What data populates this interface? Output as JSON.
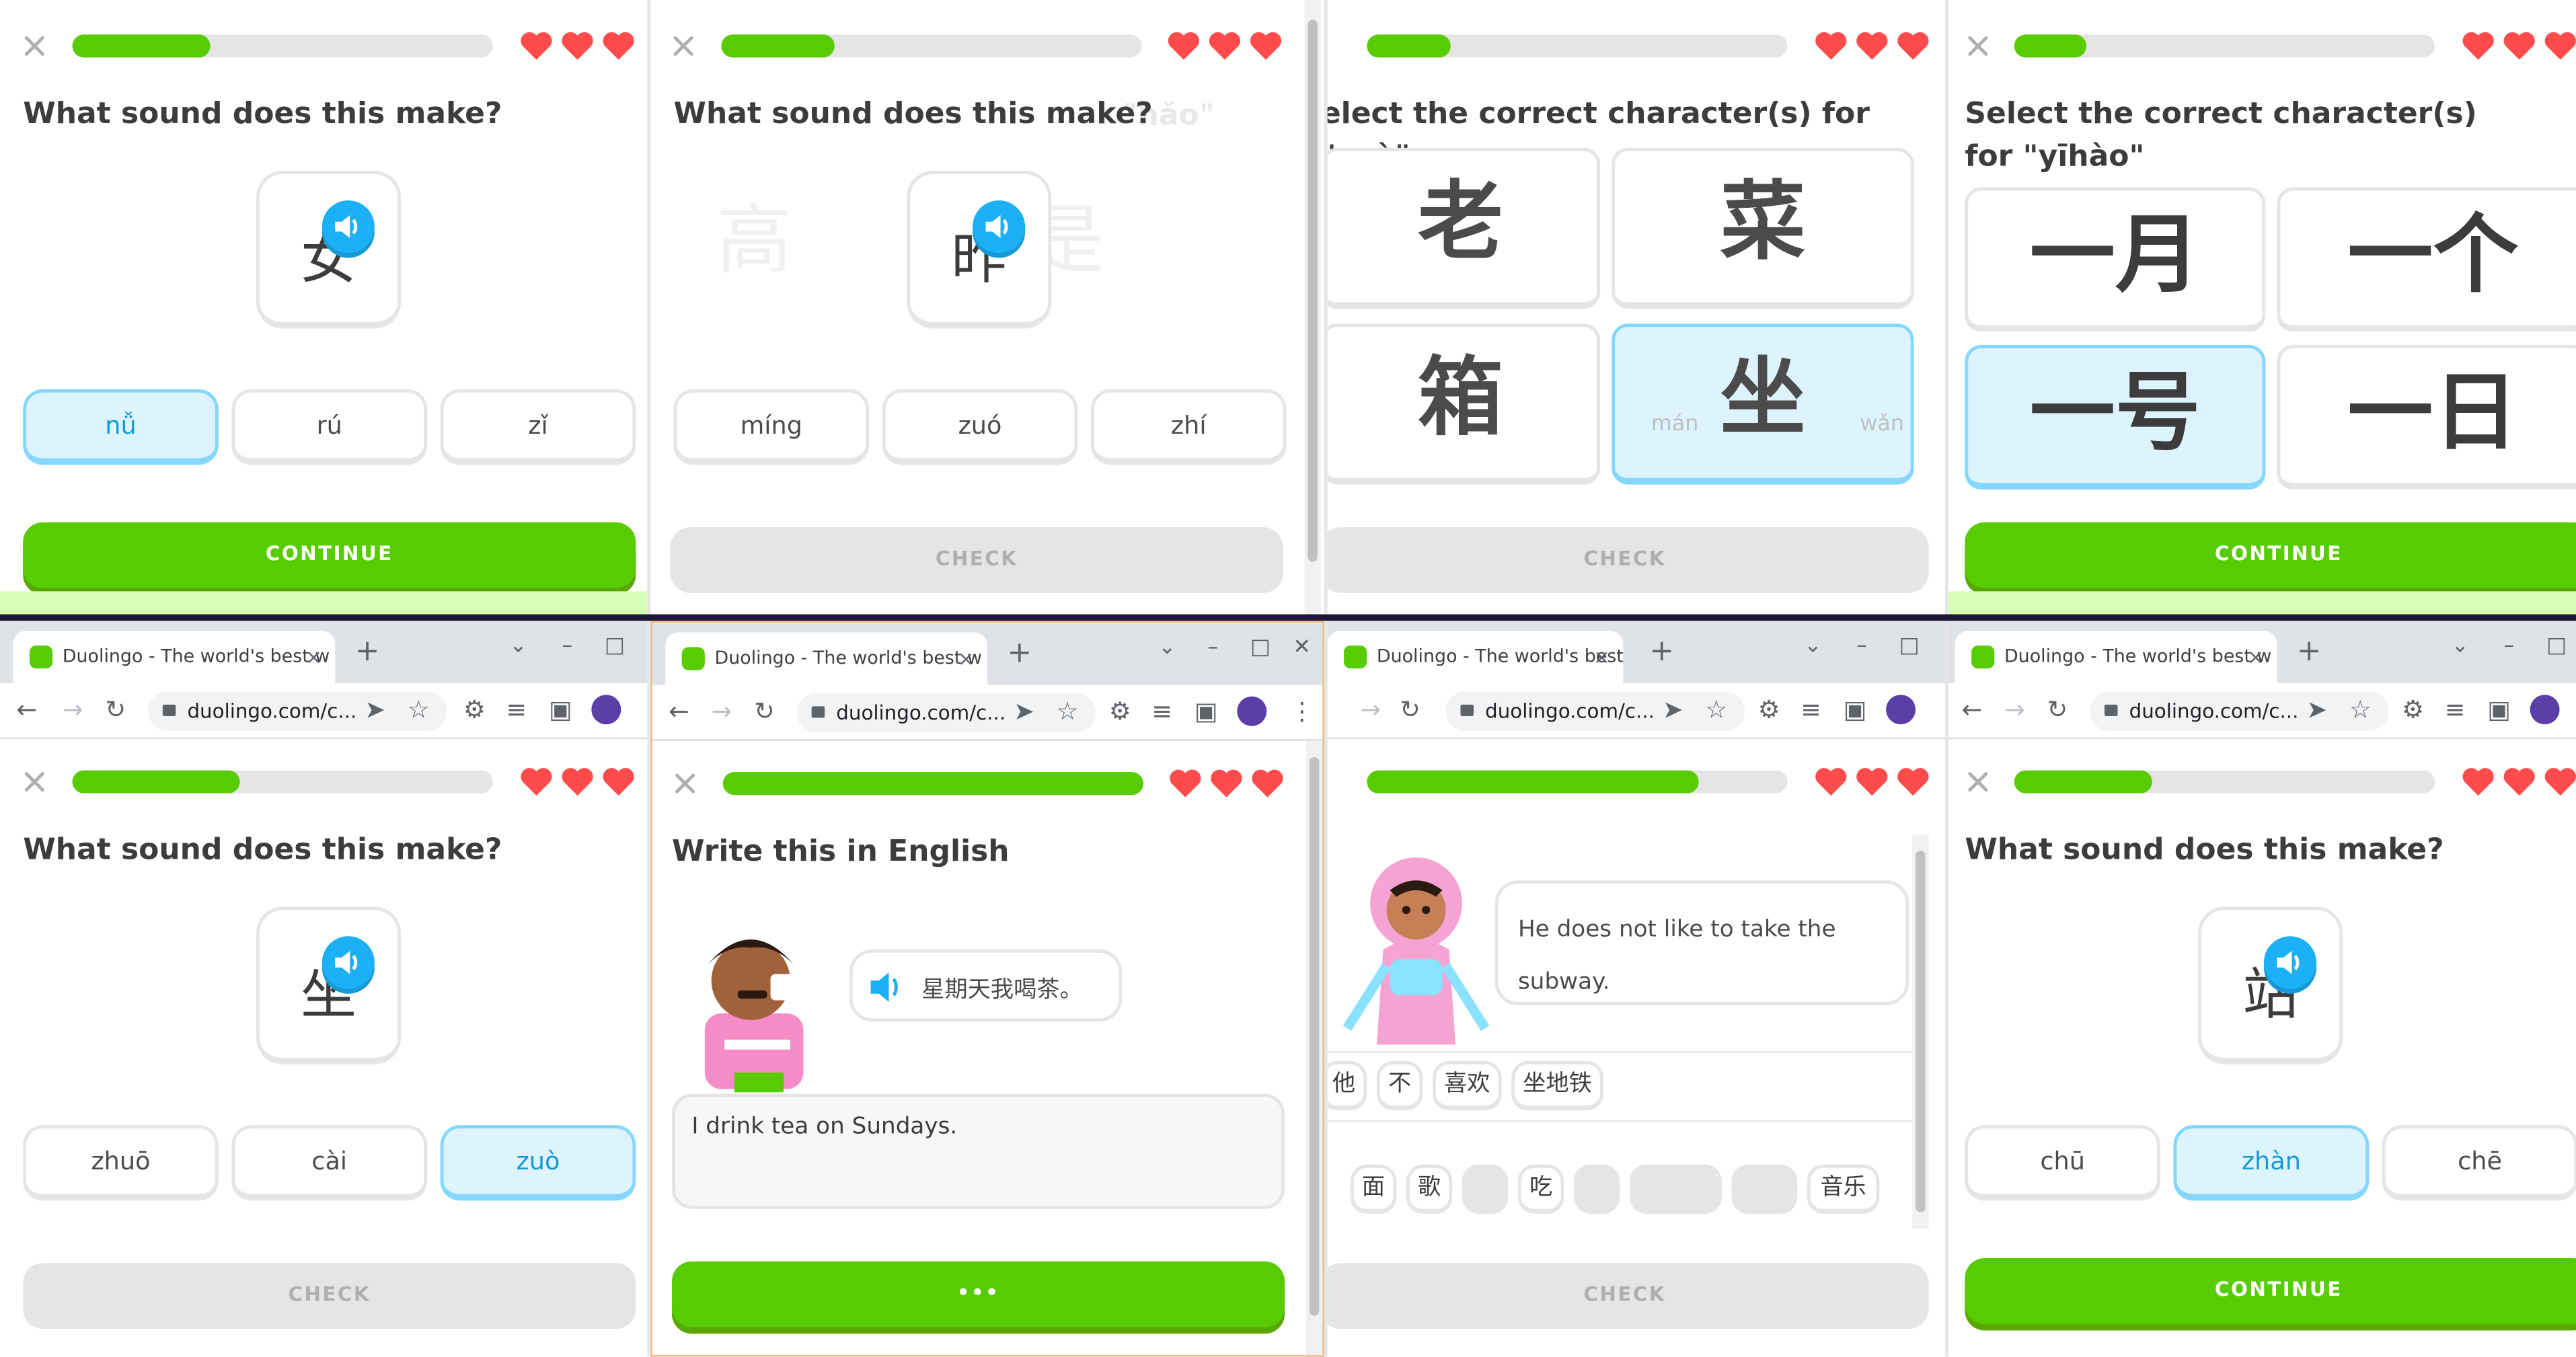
{
  "icons": {
    "close": "close-x-icon",
    "heart": "heart-icon",
    "speaker": "speaker-icon",
    "back": "back-arrow-icon",
    "forward": "forward-arrow-icon",
    "reload": "reload-icon",
    "lock": "lock-icon",
    "star": "bookmark-star-icon"
  },
  "colors": {
    "green": "#58cc02",
    "blue": "#1cb0f6",
    "selectedBg": "#ddf4ff",
    "heart": "#ff4b4b"
  },
  "browser": {
    "tab_title": "Duolingo - The world's best w",
    "tab_close": "×",
    "new_tab": "+",
    "url": "duolingo.com/c...",
    "win_controls": {
      "dropdown": "⌄",
      "minimize": "–",
      "maximize": "□",
      "close": "✕"
    }
  },
  "panes": {
    "p1": {
      "prompt": "What sound does this make?",
      "glyph": "女",
      "progress": 0.33,
      "options": [
        "nǚ",
        "rú",
        "zǐ"
      ],
      "selected": 0,
      "button": "CONTINUE"
    },
    "p2": {
      "prompt": "What sound does this make?",
      "glyph": "昨",
      "ghost": "r \"hǎo\"",
      "ghost_chars": [
        "高",
        "是"
      ],
      "progress": 0.27,
      "options": [
        "míng",
        "zuó",
        "zhí"
      ],
      "button": "CHECK"
    },
    "p3": {
      "prompt": "elect the correct character(s) for \"zuò\"",
      "tiles": [
        "老",
        "菜",
        "箱",
        "坐"
      ],
      "ghost_bits": [
        "mán",
        "wǎn"
      ],
      "selected": 3,
      "progress": 0.2,
      "button": "CHECK"
    },
    "p4": {
      "prompt": "Select the correct character(s) for \"yīhào\"",
      "tiles": [
        "一月",
        "一个",
        "一号",
        "一日"
      ],
      "selected": 2,
      "progress": 0.17,
      "button": "CONTINUE"
    },
    "p5": {
      "prompt": "What sound does this make?",
      "glyph": "坐",
      "progress": 0.4,
      "options": [
        "zhuō",
        "cài",
        "zuò"
      ],
      "selected": 2,
      "button": "CHECK"
    },
    "p6": {
      "prompt": "Write this in English",
      "sentence": "星期天我喝茶。",
      "answer": "I drink tea on Sundays.",
      "progress": 1.0,
      "button": "•••"
    },
    "p7": {
      "bubble": "He does not like to take the subway.",
      "answer_words": [
        "他",
        "不",
        "喜欢",
        "坐地铁"
      ],
      "bank_words": [
        "面",
        "歌",
        "",
        "吃",
        "",
        "",
        "",
        "音乐"
      ],
      "progress": 0.79,
      "button": "CHECK"
    },
    "p8": {
      "prompt": "What sound does this make?",
      "glyph": "站",
      "progress": 0.33,
      "options": [
        "chū",
        "zhàn",
        "chē"
      ],
      "selected": 1,
      "button": "CONTINUE"
    }
  }
}
